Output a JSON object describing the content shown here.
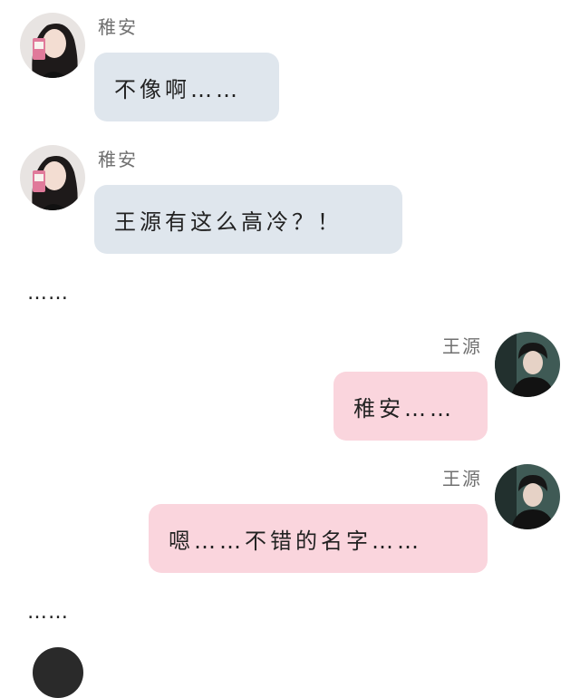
{
  "messages": [
    {
      "side": "left",
      "sender": "稚安",
      "text": "不像啊……"
    },
    {
      "side": "left",
      "sender": "稚安",
      "text": "王源有这么高冷？！"
    },
    {
      "side": "right",
      "sender": "王源",
      "text": "稚安……"
    },
    {
      "side": "right",
      "sender": "王源",
      "text": "嗯……不错的名字……"
    }
  ],
  "narration": [
    "……",
    "……"
  ],
  "colors": {
    "left_bubble": "#dfe6ed",
    "right_bubble": "#fad5dd",
    "name_text": "#707070"
  },
  "icons": {
    "female_avatar": "avatar-girl-selfie-icon",
    "male_avatar": "avatar-boy-portrait-icon"
  }
}
